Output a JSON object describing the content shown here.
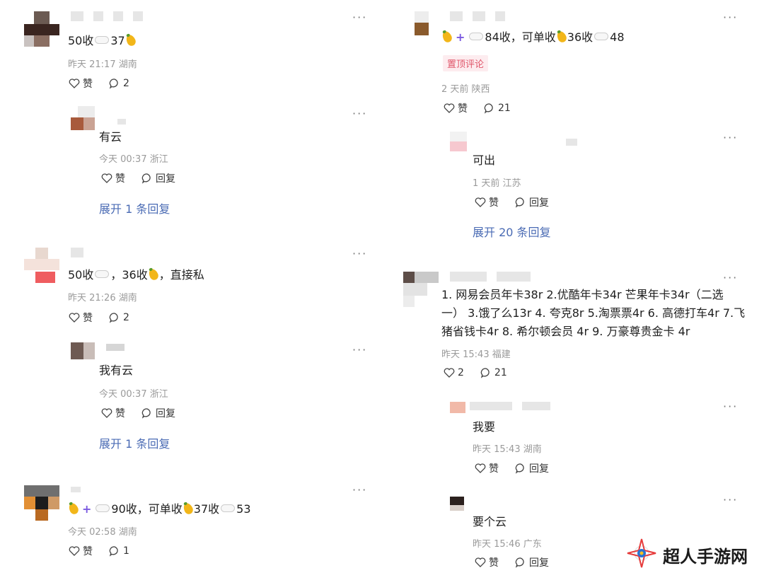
{
  "comments_left": [
    {
      "text_a": "50收",
      "text_b": "37",
      "meta": "昨天 21:17 湖南",
      "like": "赞",
      "reply_count": "2",
      "reply": {
        "text": "有云",
        "meta": "今天 00:37 浙江",
        "like": "赞",
        "reply": "回复"
      },
      "expand": "展开 1 条回复"
    },
    {
      "text_a": "50收",
      "text_b": "，36收",
      "text_c": "，直接私",
      "meta": "昨天 21:26 湖南",
      "like": "赞",
      "reply_count": "2",
      "reply": {
        "text": "我有云",
        "meta": "今天 00:37 浙江",
        "like": "赞",
        "reply": "回复"
      },
      "expand": "展开 1 条回复"
    },
    {
      "text_a": "90收，可单收",
      "text_b": "37收",
      "text_c": "53",
      "meta": "今天 02:58 湖南",
      "like": "赞",
      "reply_count": "1"
    }
  ],
  "comments_right": [
    {
      "text_a": "84收，可单收",
      "text_b": "36收",
      "text_c": "48",
      "pin": "置顶评论",
      "meta": "2 天前 陕西",
      "like": "赞",
      "reply_count": "21",
      "reply": {
        "text": "可出",
        "meta": "1 天前 江苏",
        "like": "赞",
        "reply": "回复"
      },
      "expand": "展开 20 条回复"
    },
    {
      "text": "1. 网易会员年卡38r 2.优酷年卡34r 芒果年卡34r（二选一） 3.饿了么13r 4. 夸克8r 5.淘票票4r 6. 高德打车4r 7.飞猪省钱卡4r 8. 希尔顿会员 4r 9. 万豪尊贵金卡 4r",
      "meta": "昨天 15:43 福建",
      "like_count": "2",
      "reply_count": "21",
      "reply": {
        "text": "我要",
        "meta": "昨天 15:43 湖南",
        "like": "赞",
        "reply": "回复"
      },
      "reply2": {
        "text": "要个云",
        "meta": "昨天 15:46 广东",
        "like": "赞",
        "reply": "回复"
      }
    }
  ],
  "more_label": "···",
  "watermark": "超人手游网",
  "icons": {
    "like": "heart-icon",
    "comment": "comment-icon",
    "reply": "reply-icon",
    "more": "more-icon"
  },
  "colors": {
    "link": "#4a6bb4",
    "pin": "#e0566a",
    "meta": "#9a9a9a"
  }
}
